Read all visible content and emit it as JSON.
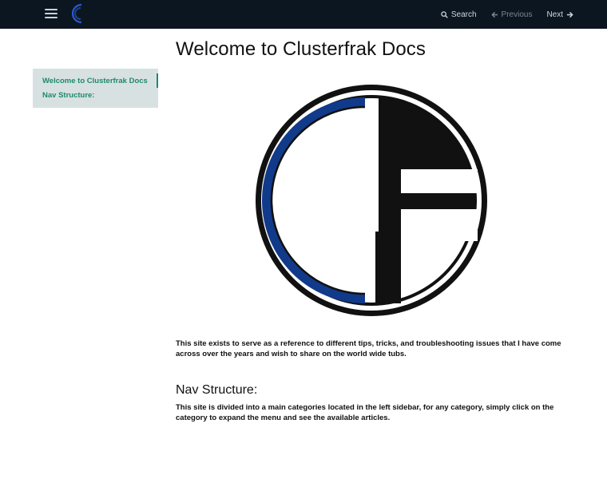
{
  "topbar": {
    "menu_icon": "hamburger-icon",
    "logo_icon": "clusterfrak-logo-icon",
    "search_label": "Search",
    "previous_label": "Previous",
    "next_label": "Next",
    "colors": {
      "background": "#0b1620",
      "link": "#d0d6dc",
      "disabled": "#7d8791"
    }
  },
  "sidebar": {
    "items": [
      {
        "label": "Welcome to Clusterfrak Docs",
        "active": true
      },
      {
        "label": "Nav Structure:",
        "active": false
      }
    ],
    "colors": {
      "background": "#d8e1e2",
      "link": "#1d8a69"
    }
  },
  "main": {
    "title": "Welcome to Clusterfrak Docs",
    "logo_icon": "clusterfrak-cf-logo",
    "logo_colors": {
      "blue": "#113a8a",
      "black": "#111111"
    },
    "intro": "This site exists to serve as a reference to different tips, tricks, and troubleshooting issues that I have come across over the years and wish to share on the world wide tubs.",
    "nav_heading": "Nav Structure:",
    "nav_text": "This site is divided into a main categories located in the left sidebar, for any category, simply click on the category to expand the menu and see the available articles."
  }
}
